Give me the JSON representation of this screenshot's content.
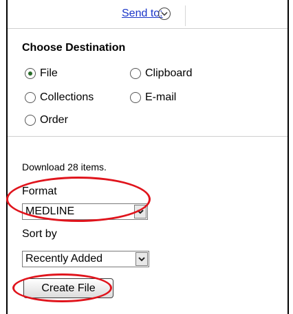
{
  "send_to": {
    "label": "Send to:",
    "icon": "chevron-down-icon"
  },
  "destination": {
    "heading": "Choose Destination",
    "options": [
      {
        "label": "File",
        "checked": true
      },
      {
        "label": "Clipboard",
        "checked": false
      },
      {
        "label": "Collections",
        "checked": false
      },
      {
        "label": "E-mail",
        "checked": false
      },
      {
        "label": "Order",
        "checked": false
      }
    ]
  },
  "download": {
    "summary": "Download 28 items.",
    "format_label": "Format",
    "format_value": "MEDLINE",
    "sort_label": "Sort by",
    "sort_value": "Recently Added",
    "create_button": "Create File"
  },
  "colors": {
    "link": "#1a35c8",
    "highlight": "#e0141c",
    "radio_checked": "#2a6c2a"
  }
}
